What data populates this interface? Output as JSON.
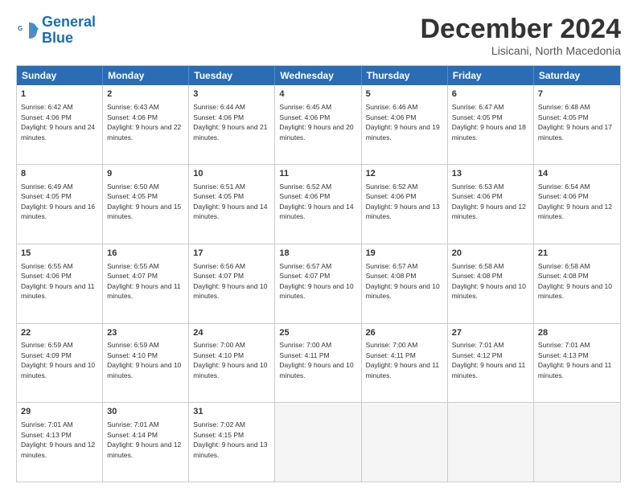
{
  "logo": {
    "line1": "General",
    "line2": "Blue"
  },
  "title": "December 2024",
  "subtitle": "Lisicani, North Macedonia",
  "header_days": [
    "Sunday",
    "Monday",
    "Tuesday",
    "Wednesday",
    "Thursday",
    "Friday",
    "Saturday"
  ],
  "weeks": [
    [
      {
        "day": "1",
        "sunrise": "Sunrise: 6:42 AM",
        "sunset": "Sunset: 4:06 PM",
        "daylight": "Daylight: 9 hours and 24 minutes."
      },
      {
        "day": "2",
        "sunrise": "Sunrise: 6:43 AM",
        "sunset": "Sunset: 4:06 PM",
        "daylight": "Daylight: 9 hours and 22 minutes."
      },
      {
        "day": "3",
        "sunrise": "Sunrise: 6:44 AM",
        "sunset": "Sunset: 4:06 PM",
        "daylight": "Daylight: 9 hours and 21 minutes."
      },
      {
        "day": "4",
        "sunrise": "Sunrise: 6:45 AM",
        "sunset": "Sunset: 4:06 PM",
        "daylight": "Daylight: 9 hours and 20 minutes."
      },
      {
        "day": "5",
        "sunrise": "Sunrise: 6:46 AM",
        "sunset": "Sunset: 4:06 PM",
        "daylight": "Daylight: 9 hours and 19 minutes."
      },
      {
        "day": "6",
        "sunrise": "Sunrise: 6:47 AM",
        "sunset": "Sunset: 4:05 PM",
        "daylight": "Daylight: 9 hours and 18 minutes."
      },
      {
        "day": "7",
        "sunrise": "Sunrise: 6:48 AM",
        "sunset": "Sunset: 4:05 PM",
        "daylight": "Daylight: 9 hours and 17 minutes."
      }
    ],
    [
      {
        "day": "8",
        "sunrise": "Sunrise: 6:49 AM",
        "sunset": "Sunset: 4:05 PM",
        "daylight": "Daylight: 9 hours and 16 minutes."
      },
      {
        "day": "9",
        "sunrise": "Sunrise: 6:50 AM",
        "sunset": "Sunset: 4:05 PM",
        "daylight": "Daylight: 9 hours and 15 minutes."
      },
      {
        "day": "10",
        "sunrise": "Sunrise: 6:51 AM",
        "sunset": "Sunset: 4:05 PM",
        "daylight": "Daylight: 9 hours and 14 minutes."
      },
      {
        "day": "11",
        "sunrise": "Sunrise: 6:52 AM",
        "sunset": "Sunset: 4:06 PM",
        "daylight": "Daylight: 9 hours and 14 minutes."
      },
      {
        "day": "12",
        "sunrise": "Sunrise: 6:52 AM",
        "sunset": "Sunset: 4:06 PM",
        "daylight": "Daylight: 9 hours and 13 minutes."
      },
      {
        "day": "13",
        "sunrise": "Sunrise: 6:53 AM",
        "sunset": "Sunset: 4:06 PM",
        "daylight": "Daylight: 9 hours and 12 minutes."
      },
      {
        "day": "14",
        "sunrise": "Sunrise: 6:54 AM",
        "sunset": "Sunset: 4:06 PM",
        "daylight": "Daylight: 9 hours and 12 minutes."
      }
    ],
    [
      {
        "day": "15",
        "sunrise": "Sunrise: 6:55 AM",
        "sunset": "Sunset: 4:06 PM",
        "daylight": "Daylight: 9 hours and 11 minutes."
      },
      {
        "day": "16",
        "sunrise": "Sunrise: 6:55 AM",
        "sunset": "Sunset: 4:07 PM",
        "daylight": "Daylight: 9 hours and 11 minutes."
      },
      {
        "day": "17",
        "sunrise": "Sunrise: 6:56 AM",
        "sunset": "Sunset: 4:07 PM",
        "daylight": "Daylight: 9 hours and 10 minutes."
      },
      {
        "day": "18",
        "sunrise": "Sunrise: 6:57 AM",
        "sunset": "Sunset: 4:07 PM",
        "daylight": "Daylight: 9 hours and 10 minutes."
      },
      {
        "day": "19",
        "sunrise": "Sunrise: 6:57 AM",
        "sunset": "Sunset: 4:08 PM",
        "daylight": "Daylight: 9 hours and 10 minutes."
      },
      {
        "day": "20",
        "sunrise": "Sunrise: 6:58 AM",
        "sunset": "Sunset: 4:08 PM",
        "daylight": "Daylight: 9 hours and 10 minutes."
      },
      {
        "day": "21",
        "sunrise": "Sunrise: 6:58 AM",
        "sunset": "Sunset: 4:08 PM",
        "daylight": "Daylight: 9 hours and 10 minutes."
      }
    ],
    [
      {
        "day": "22",
        "sunrise": "Sunrise: 6:59 AM",
        "sunset": "Sunset: 4:09 PM",
        "daylight": "Daylight: 9 hours and 10 minutes."
      },
      {
        "day": "23",
        "sunrise": "Sunrise: 6:59 AM",
        "sunset": "Sunset: 4:10 PM",
        "daylight": "Daylight: 9 hours and 10 minutes."
      },
      {
        "day": "24",
        "sunrise": "Sunrise: 7:00 AM",
        "sunset": "Sunset: 4:10 PM",
        "daylight": "Daylight: 9 hours and 10 minutes."
      },
      {
        "day": "25",
        "sunrise": "Sunrise: 7:00 AM",
        "sunset": "Sunset: 4:11 PM",
        "daylight": "Daylight: 9 hours and 10 minutes."
      },
      {
        "day": "26",
        "sunrise": "Sunrise: 7:00 AM",
        "sunset": "Sunset: 4:11 PM",
        "daylight": "Daylight: 9 hours and 11 minutes."
      },
      {
        "day": "27",
        "sunrise": "Sunrise: 7:01 AM",
        "sunset": "Sunset: 4:12 PM",
        "daylight": "Daylight: 9 hours and 11 minutes."
      },
      {
        "day": "28",
        "sunrise": "Sunrise: 7:01 AM",
        "sunset": "Sunset: 4:13 PM",
        "daylight": "Daylight: 9 hours and 11 minutes."
      }
    ],
    [
      {
        "day": "29",
        "sunrise": "Sunrise: 7:01 AM",
        "sunset": "Sunset: 4:13 PM",
        "daylight": "Daylight: 9 hours and 12 minutes."
      },
      {
        "day": "30",
        "sunrise": "Sunrise: 7:01 AM",
        "sunset": "Sunset: 4:14 PM",
        "daylight": "Daylight: 9 hours and 12 minutes."
      },
      {
        "day": "31",
        "sunrise": "Sunrise: 7:02 AM",
        "sunset": "Sunset: 4:15 PM",
        "daylight": "Daylight: 9 hours and 13 minutes."
      },
      null,
      null,
      null,
      null
    ]
  ]
}
